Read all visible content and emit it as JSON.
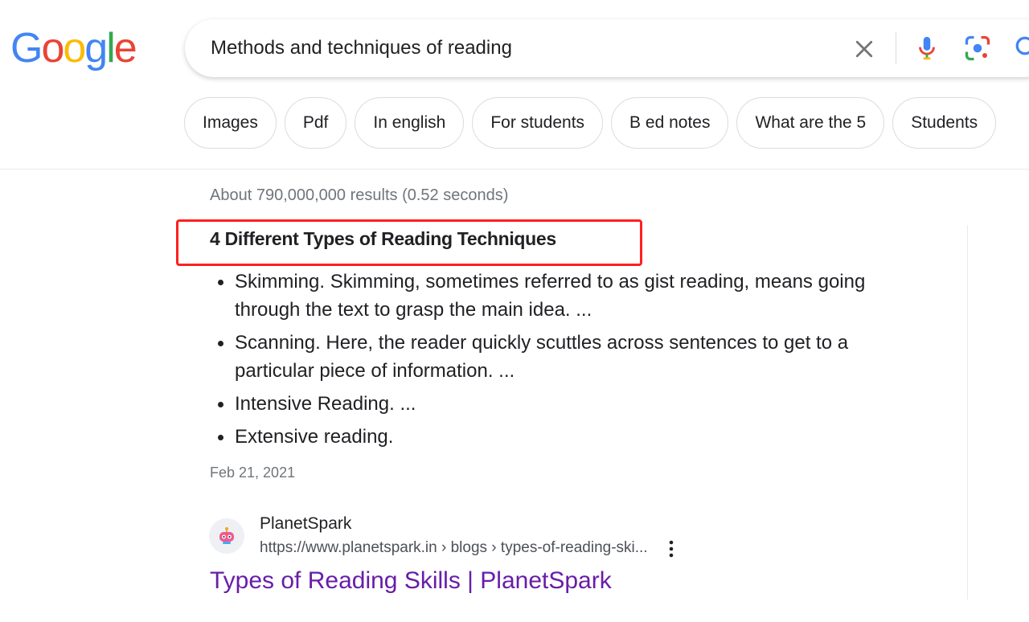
{
  "logo": {
    "letters": [
      "G",
      "o",
      "o",
      "g",
      "l",
      "e"
    ],
    "colors": [
      "#4285F4",
      "#EA4335",
      "#FBBC05",
      "#4285F4",
      "#34A853",
      "#EA4335"
    ]
  },
  "search": {
    "query": "Methods and techniques of reading",
    "icons": [
      "close-icon",
      "mic-icon",
      "lens-icon",
      "search-icon"
    ]
  },
  "chips": [
    "Images",
    "Pdf",
    "In english",
    "For students",
    "B ed notes",
    "What are the 5",
    "Students"
  ],
  "results_stats": "About 790,000,000 results (0.52 seconds)",
  "featured_snippet": {
    "title": "4 Different Types of Reading Techniques",
    "highlight_color": "#ff1f1f",
    "bullets": [
      "Skimming. Skimming, sometimes referred to as gist reading, means going through the text to grasp the main idea. ...",
      "Scanning. Here, the reader quickly scuttles across sentences to get to a particular piece of information. ...",
      "Intensive Reading. ...",
      "Extensive reading."
    ],
    "date": "Feb 21, 2021"
  },
  "result": {
    "site_name": "PlanetSpark",
    "url": "https://www.planetspark.in › blogs › types-of-reading-ski...",
    "title": "Types of Reading Skills | PlanetSpark",
    "title_color": "#681da8"
  }
}
